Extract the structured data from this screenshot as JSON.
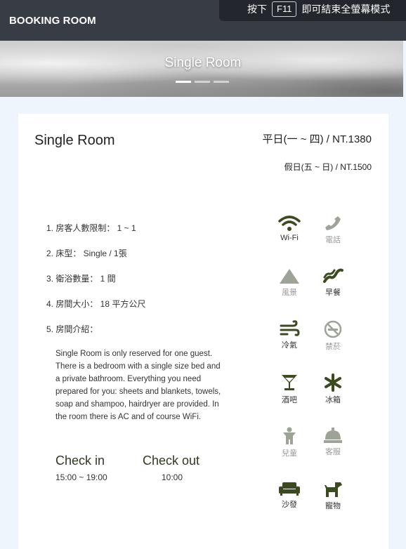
{
  "navbar": {
    "brand": "BOOKING ROOM"
  },
  "fullscreen_notice": {
    "before": "按下",
    "key": "F11",
    "after": "即可結束全螢幕模式"
  },
  "hero": {
    "title": "Single Room",
    "slide_count": 3,
    "active_slide": 1
  },
  "room": {
    "title": "Single Room",
    "price_weekday": "平日(一 ~ 四) / NT.1380",
    "price_weekend": "假日(五 ~ 日) / NT.1500",
    "info": [
      "1. 房客人數限制： 1 ~ 1",
      "2. 床型： Single / 1張",
      "3. 衛浴數量： 1 間",
      "4. 房間大小： 18 平方公尺",
      "5. 房間介紹："
    ],
    "description": "Single Room is only reserved for one guest. There is a bedroom with a single size bed and a private bathroom. Everything you need prepared for you: sheets and blankets, towels, soap and shampoo, hairdryer are provided. In the room there is AC and of course WiFi.",
    "check_in_label": "Check in",
    "check_in_time": "15:00 ~ 19:00",
    "check_out_label": "Check out",
    "check_out_time": "10:00"
  },
  "amenities": [
    {
      "label": "Wi-Fi",
      "icon": "wifi-icon",
      "available": true
    },
    {
      "label": "電話",
      "icon": "phone-icon",
      "available": false
    },
    {
      "label": "風景",
      "icon": "mountain-icon",
      "available": false
    },
    {
      "label": "早餐",
      "icon": "bacon-icon",
      "available": true
    },
    {
      "label": "冷氣",
      "icon": "wind-icon",
      "available": true
    },
    {
      "label": "禁菸",
      "icon": "no-smoking-icon",
      "available": false
    },
    {
      "label": "酒吧",
      "icon": "cocktail-icon",
      "available": true
    },
    {
      "label": "冰箱",
      "icon": "snowflake-icon",
      "available": true
    },
    {
      "label": "兒童",
      "icon": "child-icon",
      "available": false
    },
    {
      "label": "客服",
      "icon": "bell-icon",
      "available": false
    },
    {
      "label": "沙發",
      "icon": "couch-icon",
      "available": true
    },
    {
      "label": "寵物",
      "icon": "dog-icon",
      "available": true
    }
  ],
  "colors": {
    "navbar": "#383c44",
    "accent": "#3c4a20",
    "disabled": "#9ea397",
    "page_bg": "#eef5fd"
  }
}
